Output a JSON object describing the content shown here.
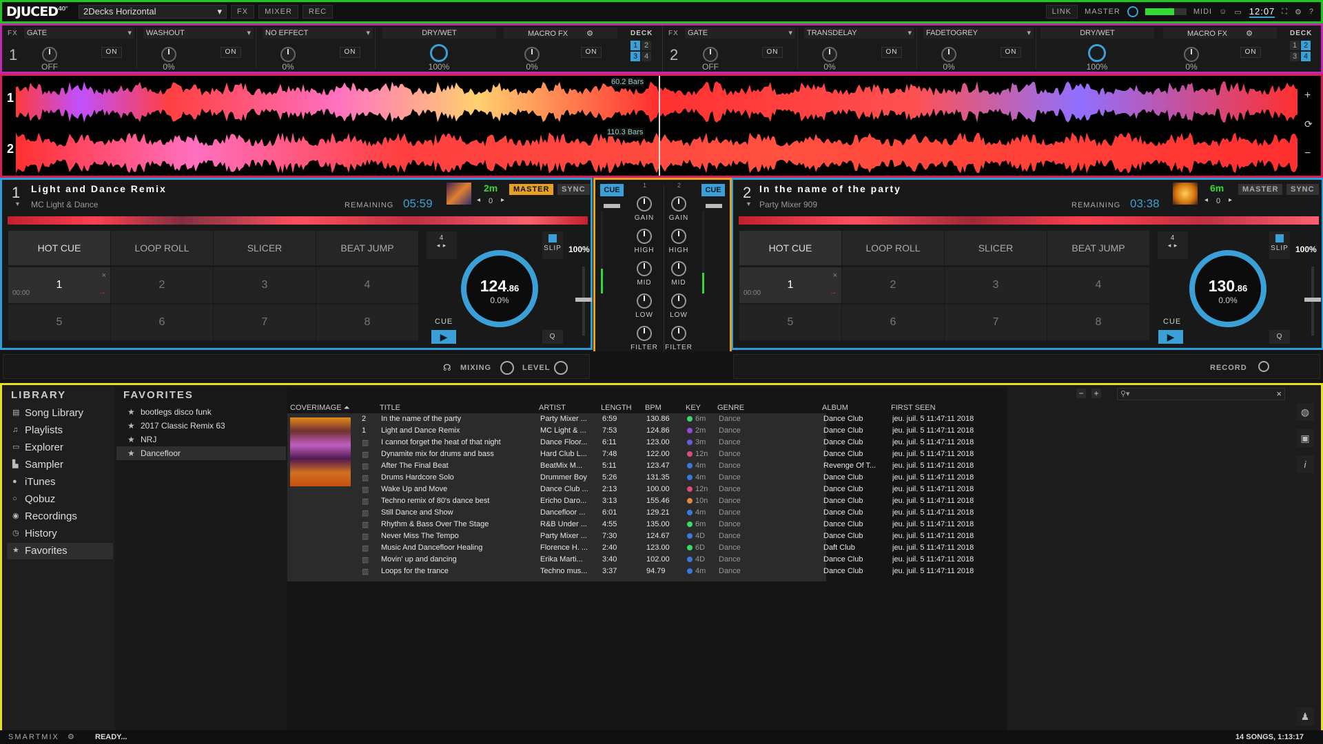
{
  "app": {
    "logo": "DJUCED",
    "logo_sup": "40°",
    "layout": "2Decks Horizontal",
    "fx": "FX",
    "mixer": "MIXER",
    "rec": "REC"
  },
  "topright": {
    "link": "LINK",
    "master": "MASTER",
    "midi": "MIDI",
    "clock": "12:07"
  },
  "fx": {
    "fx_label": "FX",
    "deck_label": "DECK",
    "drywet": "DRY/WET",
    "macro": "MACRO FX",
    "left": {
      "deck": "1",
      "units": [
        {
          "name": "GATE",
          "value": "OFF",
          "on": "ON"
        },
        {
          "name": "WASHOUT",
          "value": "0%",
          "on": "ON"
        },
        {
          "name": "NO EFFECT",
          "value": "0%",
          "on": "ON"
        }
      ],
      "drywet_value": "100%",
      "macro_value": "0%",
      "macro_on": "ON"
    },
    "right": {
      "deck": "2",
      "units": [
        {
          "name": "GATE",
          "value": "OFF",
          "on": "ON"
        },
        {
          "name": "TRANSDELAY",
          "value": "0%",
          "on": "ON"
        },
        {
          "name": "FADETOGREY",
          "value": "0%",
          "on": "ON"
        }
      ],
      "drywet_value": "100%",
      "macro_value": "0%",
      "macro_on": "ON"
    }
  },
  "waves": {
    "deck1": "1",
    "deck2": "2",
    "bars1": "60.2 Bars",
    "bars2": "110.3 Bars"
  },
  "deck1": {
    "num": "1",
    "title": "Light and Dance Remix",
    "artist": "MC Light & Dance",
    "remaining_label": "REMAINING",
    "remaining": "05:59",
    "key": "2m",
    "master": "MASTER",
    "sync": "SYNC",
    "pitch_offset": "0",
    "tabs": [
      "HOT CUE",
      "LOOP ROLL",
      "SLICER",
      "BEAT JUMP"
    ],
    "pads": [
      "1",
      "2",
      "3",
      "4",
      "5",
      "6",
      "7",
      "8"
    ],
    "pad1_time": "00:00",
    "loop": "4",
    "slip": "SLIP",
    "pct": "100%",
    "bpm": "124",
    "bpm_dec": ".86",
    "pitch": "0.0%",
    "cue": "CUE",
    "q": "Q"
  },
  "deck2": {
    "num": "2",
    "title": "In the name of the party",
    "artist": "Party Mixer 909",
    "remaining_label": "REMAINING",
    "remaining": "03:38",
    "key": "6m",
    "master": "MASTER",
    "sync": "SYNC",
    "pitch_offset": "0",
    "tabs": [
      "HOT CUE",
      "LOOP ROLL",
      "SLICER",
      "BEAT JUMP"
    ],
    "pads": [
      "1",
      "2",
      "3",
      "4",
      "5",
      "6",
      "7",
      "8"
    ],
    "pad1_time": "00:00",
    "loop": "4",
    "slip": "SLIP",
    "pct": "100%",
    "bpm": "130",
    "bpm_dec": ".86",
    "pitch": "0.0%",
    "cue": "CUE",
    "q": "Q"
  },
  "mixer": {
    "cue": "CUE",
    "ch1": "1",
    "ch2": "2",
    "labels": [
      "GAIN",
      "HIGH",
      "MID",
      "LOW",
      "FILTER"
    ],
    "assign": [
      "1",
      "2",
      "3",
      "4"
    ]
  },
  "mixrow": {
    "mixing": "MIXING",
    "level": "LEVEL",
    "record": "RECORD"
  },
  "library": {
    "head": "LIBRARY",
    "items": [
      "Song Library",
      "Playlists",
      "Explorer",
      "Sampler",
      "iTunes",
      "Qobuz",
      "Recordings",
      "History",
      "Favorites"
    ],
    "fav_head": "FAVORITES",
    "favorites": [
      "bootlegs disco funk",
      "2017 Classic Remix 63",
      "NRJ",
      "Dancefloor"
    ],
    "columns": [
      "COVERIMAGE",
      "TITLE",
      "ARTIST",
      "LENGTH",
      "BPM",
      "KEY",
      "GENRE",
      "ALBUM",
      "FIRST SEEN"
    ],
    "rows": [
      {
        "n": "2",
        "title": "In the name of the party",
        "artist": "Party Mixer ...",
        "length": "6:59",
        "bpm": "130.86",
        "key": "6m",
        "kc": "#3bd86a",
        "genre": "Dance",
        "album": "Dance Club",
        "seen": "jeu. juil. 5 11:47:11 2018"
      },
      {
        "n": "1",
        "title": "Light and Dance Remix",
        "artist": "MC Light & ...",
        "length": "7:53",
        "bpm": "124.86",
        "key": "2m",
        "kc": "#9a4ad8",
        "genre": "Dance",
        "album": "Dance Club",
        "seen": "jeu. juil. 5 11:47:11 2018"
      },
      {
        "n": "",
        "title": "I cannot forget the heat of that night",
        "artist": "Dance Floor...",
        "length": "6:11",
        "bpm": "123.00",
        "key": "3m",
        "kc": "#6a5ae0",
        "genre": "Dance",
        "album": "Dance Club",
        "seen": "jeu. juil. 5 11:47:11 2018"
      },
      {
        "n": "",
        "title": "Dynamite mix for drums and bass",
        "artist": "Hard Club L...",
        "length": "7:48",
        "bpm": "122.00",
        "key": "12n",
        "kc": "#e04a7a",
        "genre": "Dance",
        "album": "Dance Club",
        "seen": "jeu. juil. 5 11:47:11 2018"
      },
      {
        "n": "",
        "title": "After The Final Beat",
        "artist": "BeatMix M...",
        "length": "5:11",
        "bpm": "123.47",
        "key": "4m",
        "kc": "#3a7ae0",
        "genre": "Dance",
        "album": "Revenge Of T...",
        "seen": "jeu. juil. 5 11:47:11 2018"
      },
      {
        "n": "",
        "title": "Drums Hardcore Solo",
        "artist": "Drummer Boy",
        "length": "5:26",
        "bpm": "131.35",
        "key": "4m",
        "kc": "#3a7ae0",
        "genre": "Dance",
        "album": "Dance Club",
        "seen": "jeu. juil. 5 11:47:11 2018"
      },
      {
        "n": "",
        "title": "Wake Up and Move",
        "artist": "Dance Club ...",
        "length": "2:13",
        "bpm": "100.00",
        "key": "12n",
        "kc": "#e04a7a",
        "genre": "Dance",
        "album": "Dance Club",
        "seen": "jeu. juil. 5 11:47:11 2018"
      },
      {
        "n": "",
        "title": "Techno remix of 80's dance best",
        "artist": "Ericho Daro...",
        "length": "3:13",
        "bpm": "155.46",
        "key": "10n",
        "kc": "#e08a3a",
        "genre": "Dance",
        "album": "Dance Club",
        "seen": "jeu. juil. 5 11:47:11 2018"
      },
      {
        "n": "",
        "title": "Still Dance and Show",
        "artist": "Dancefloor ...",
        "length": "6:01",
        "bpm": "129.21",
        "key": "4m",
        "kc": "#3a7ae0",
        "genre": "Dance",
        "album": "Dance Club",
        "seen": "jeu. juil. 5 11:47:11 2018"
      },
      {
        "n": "",
        "title": "Rhythm & Bass Over The Stage",
        "artist": "R&B Under ...",
        "length": "4:55",
        "bpm": "135.00",
        "key": "6m",
        "kc": "#3bd86a",
        "genre": "Dance",
        "album": "Dance Club",
        "seen": "jeu. juil. 5 11:47:11 2018"
      },
      {
        "n": "",
        "title": "Never Miss The Tempo",
        "artist": "Party Mixer ...",
        "length": "7:30",
        "bpm": "124.67",
        "key": "4D",
        "kc": "#3a7ae0",
        "genre": "Dance",
        "album": "Dance Club",
        "seen": "jeu. juil. 5 11:47:11 2018"
      },
      {
        "n": "",
        "title": "Music And Dancefloor Healing",
        "artist": "Florence H. ...",
        "length": "2:40",
        "bpm": "123.00",
        "key": "6D",
        "kc": "#3bd86a",
        "genre": "Dance",
        "album": "Daft Club",
        "seen": "jeu. juil. 5 11:47:11 2018"
      },
      {
        "n": "",
        "title": "Movin' up and dancing",
        "artist": "Erika Marti...",
        "length": "3:40",
        "bpm": "102.00",
        "key": "4D",
        "kc": "#3a7ae0",
        "genre": "Dance",
        "album": "Dance Club",
        "seen": "jeu. juil. 5 11:47:11 2018"
      },
      {
        "n": "",
        "title": "Loops for the trance",
        "artist": "Techno mus...",
        "length": "3:37",
        "bpm": "94.79",
        "key": "4m",
        "kc": "#3a7ae0",
        "genre": "Dance",
        "album": "Dance Club",
        "seen": "jeu. juil. 5 11:47:11 2018"
      }
    ]
  },
  "status": {
    "smartmix": "SMARTMIX",
    "ready": "READY...",
    "count": "14 SONGS, 1:13:17"
  },
  "colors": {
    "accent": "#3ba0d8",
    "master": "#e8a020",
    "key_green": "#35d835"
  }
}
